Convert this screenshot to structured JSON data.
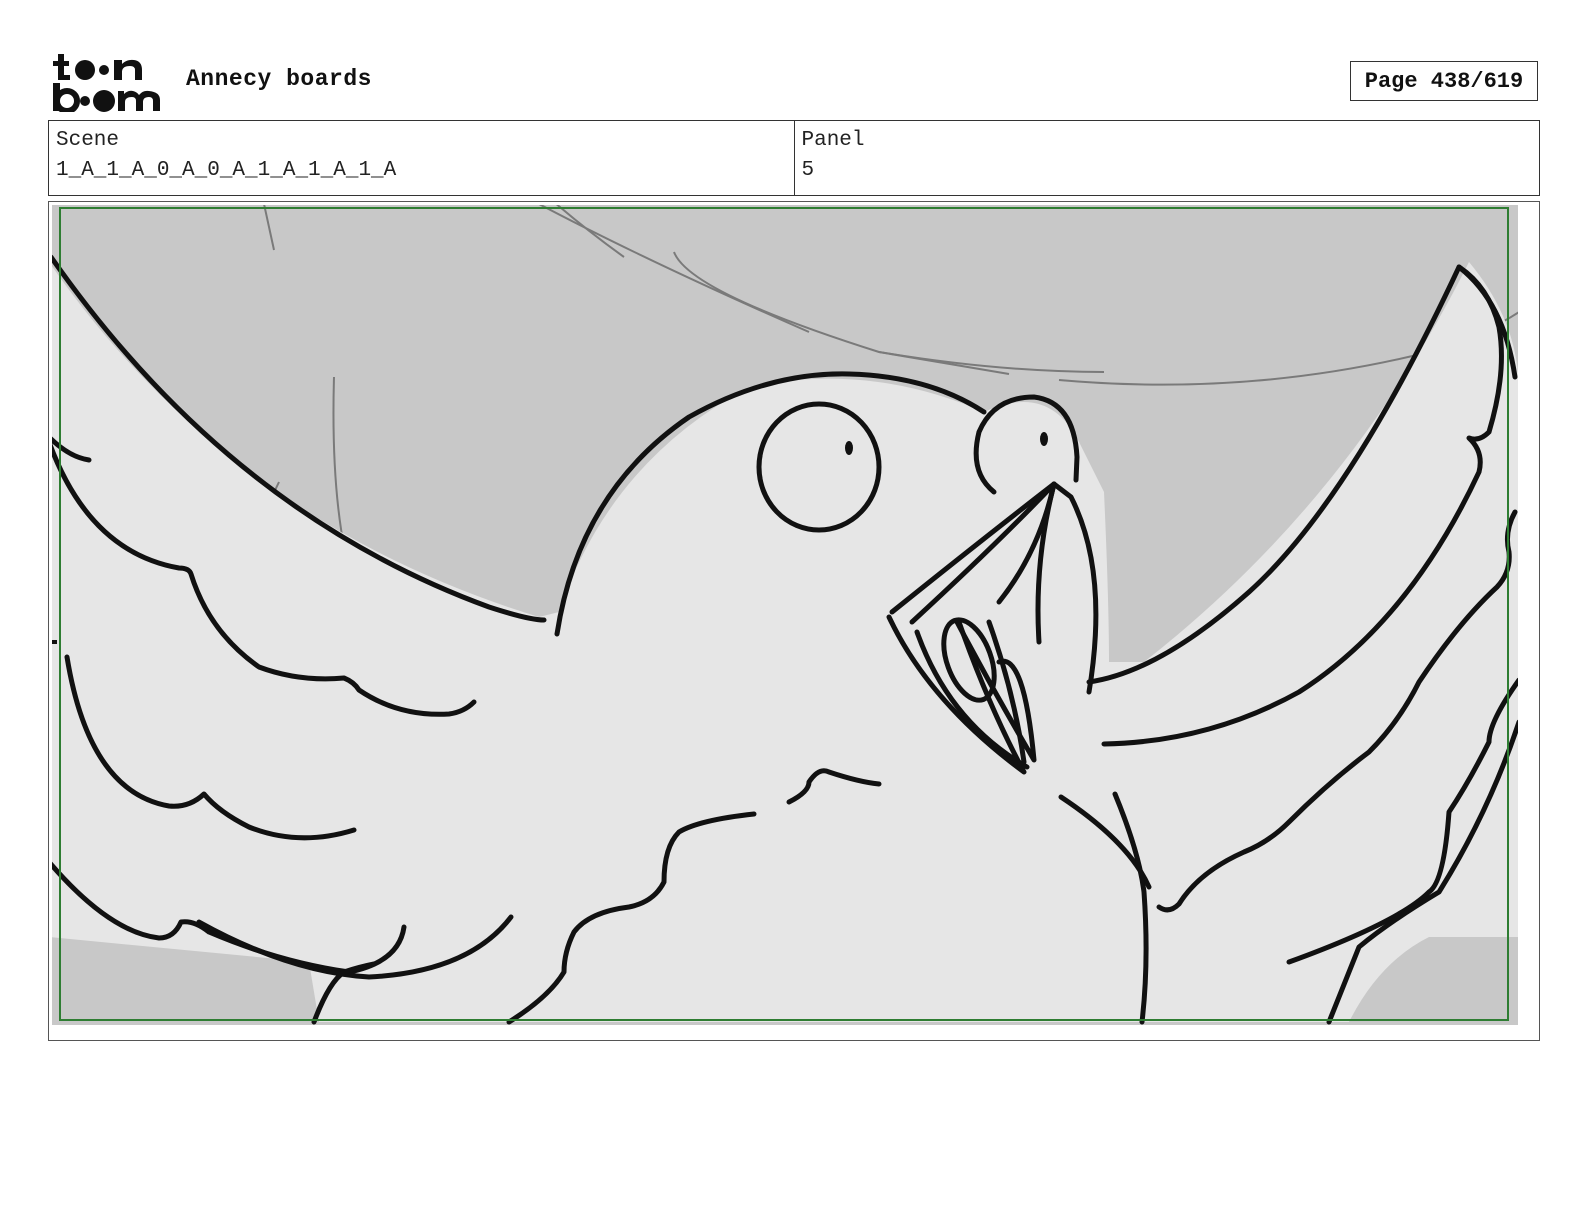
{
  "header": {
    "logo_icon": "toon-boom-logo",
    "project_title": "Annecy boards",
    "page_label": "Page 438/619"
  },
  "info": {
    "scene_label": "Scene",
    "scene_value": "1_A_1_A_0_A_0_A_1_A_1_A_1_A",
    "panel_label": "Panel",
    "panel_value": "5"
  },
  "panel_image": {
    "icon": "storyboard-sketch-bird-wings-spread",
    "safe_area_color": "#2e7d32",
    "background_color": "#c8c8c8",
    "figure_color": "#e6e6e6"
  }
}
